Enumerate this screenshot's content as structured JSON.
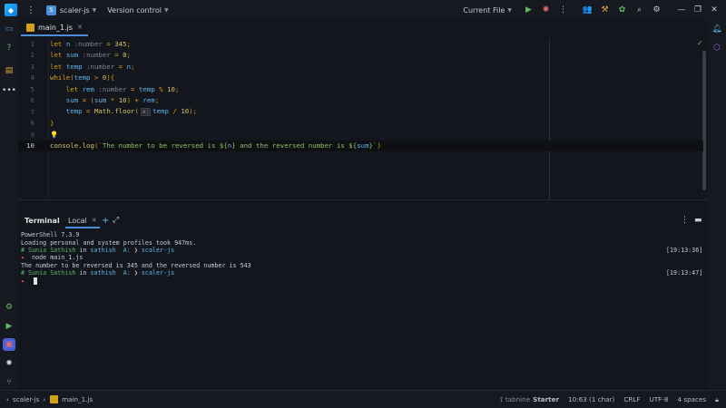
{
  "app": {
    "project_badge": "S",
    "project_name": "scaler-js",
    "version_control": "Version control",
    "run_config": "Current File"
  },
  "editor": {
    "tab": {
      "label": "main_1.js"
    },
    "lines": [
      {
        "no": "1",
        "parts": [
          [
            "kw",
            "let "
          ],
          [
            "id",
            "n"
          ],
          [
            "hint",
            " :"
          ],
          [
            "hint",
            "number"
          ],
          [
            "op",
            " = "
          ],
          [
            "num",
            "345"
          ],
          [
            "op",
            ";"
          ]
        ]
      },
      {
        "no": "2",
        "parts": [
          [
            "kw",
            "let "
          ],
          [
            "id",
            "sum"
          ],
          [
            "hint",
            " :"
          ],
          [
            "hint",
            "number"
          ],
          [
            "op",
            " = "
          ],
          [
            "num",
            "0"
          ],
          [
            "op",
            ";"
          ]
        ]
      },
      {
        "no": "3",
        "parts": [
          [
            "kw",
            "let "
          ],
          [
            "id",
            "temp"
          ],
          [
            "hint",
            " :"
          ],
          [
            "hint",
            "number"
          ],
          [
            "op",
            " = "
          ],
          [
            "id",
            "n"
          ],
          [
            "op",
            ";"
          ]
        ]
      },
      {
        "no": "4",
        "parts": [
          [
            "kw",
            "while"
          ],
          [
            "op",
            "("
          ],
          [
            "id",
            "temp"
          ],
          [
            "op",
            " > "
          ],
          [
            "num",
            "0"
          ],
          [
            "op",
            "){"
          ]
        ]
      },
      {
        "no": "5",
        "parts": [
          [
            "kw",
            "    let "
          ],
          [
            "id",
            "rem"
          ],
          [
            "hint",
            " :"
          ],
          [
            "hint",
            "number"
          ],
          [
            "op",
            " = "
          ],
          [
            "id",
            "temp"
          ],
          [
            "op",
            " % "
          ],
          [
            "num",
            "10"
          ],
          [
            "op",
            ";"
          ]
        ]
      },
      {
        "no": "6",
        "parts": [
          [
            "id",
            "    sum"
          ],
          [
            "op",
            " = ("
          ],
          [
            "id",
            "sum"
          ],
          [
            "op",
            " * "
          ],
          [
            "num",
            "10"
          ],
          [
            "op",
            ") + "
          ],
          [
            "id",
            "rem"
          ],
          [
            "op",
            ";"
          ]
        ]
      },
      {
        "no": "7",
        "parts": [
          [
            "id",
            "    temp"
          ],
          [
            "op",
            " = "
          ],
          [
            "fn",
            "Math.floor"
          ],
          [
            "op",
            "("
          ],
          [
            "hintbox",
            "x:"
          ],
          [
            "id",
            "temp"
          ],
          [
            "op",
            " / "
          ],
          [
            "num",
            "10"
          ],
          [
            "op",
            ");"
          ]
        ]
      },
      {
        "no": "8",
        "parts": [
          [
            "op",
            "}"
          ]
        ]
      },
      {
        "no": "9",
        "parts": [
          [
            "bulb",
            "💡"
          ]
        ]
      },
      {
        "no": "10",
        "parts": [
          [
            "fn",
            "console.log"
          ],
          [
            "op",
            "("
          ],
          [
            "str",
            "`The number to be reversed is ${"
          ],
          [
            "id",
            "n"
          ],
          [
            "str",
            "} and the reversed number is ${"
          ],
          [
            "id",
            "sum"
          ],
          [
            "str",
            "}`"
          ],
          [
            "op",
            ")"
          ]
        ]
      }
    ]
  },
  "terminal": {
    "title": "Terminal",
    "tab_label": "Local",
    "lines": [
      {
        "parts": [
          [
            "plain",
            "PowerShell 7.3.9"
          ]
        ],
        "ts": ""
      },
      {
        "parts": [
          [
            "plain",
            "Loading personal and system profiles took 947ms."
          ]
        ],
        "ts": ""
      },
      {
        "parts": [
          [
            "g",
            "# Sunia Sathish "
          ],
          [
            "plain",
            "in "
          ],
          [
            "b",
            "sathish  A: "
          ],
          [
            "plain",
            "❯ "
          ],
          [
            "b",
            "scaler-js"
          ]
        ],
        "ts": "[19:13:36]"
      },
      {
        "parts": [
          [
            "arrow",
            "✦ "
          ],
          [
            "plain",
            " node main_1.js"
          ]
        ],
        "ts": ""
      },
      {
        "parts": [
          [
            "plain",
            "The number to be reversed is 345 and the reversed number is 543"
          ]
        ],
        "ts": ""
      },
      {
        "parts": [
          [
            "g",
            "# Sunia Sathish "
          ],
          [
            "plain",
            "in "
          ],
          [
            "b",
            "sathish  A: "
          ],
          [
            "plain",
            "❯ "
          ],
          [
            "b",
            "scaler-js"
          ]
        ],
        "ts": "[19:13:47]"
      },
      {
        "parts": [
          [
            "arrow",
            "✦ "
          ]
        ],
        "ts": "",
        "cursor": true
      }
    ]
  },
  "status": {
    "breadcrumb_project": "scaler-js",
    "breadcrumb_file": "main_1.js",
    "tabnine_brand": "tabnine",
    "tabnine_plan": "Starter",
    "position": "10:63 (1 char)",
    "line_sep": "CRLF",
    "encoding": "UTF-8",
    "indent": "4 spaces"
  },
  "icons": {
    "left_strip": [
      "monitor-icon",
      "help-icon",
      "structure-icon",
      "more-icon",
      "settings-icon",
      "run-icon",
      "terminal-icon",
      "problems-icon",
      "git-icon"
    ],
    "right_strip": [
      "notifications-icon",
      "ai-assistant-icon"
    ]
  },
  "colors": {
    "accent": "#4a8fd8",
    "keyword": "#d4a017",
    "identifier": "#5fb5e8",
    "string": "#8fbf63",
    "prompt_green": "#5fb865",
    "prompt_arrow": "#e06c75"
  }
}
